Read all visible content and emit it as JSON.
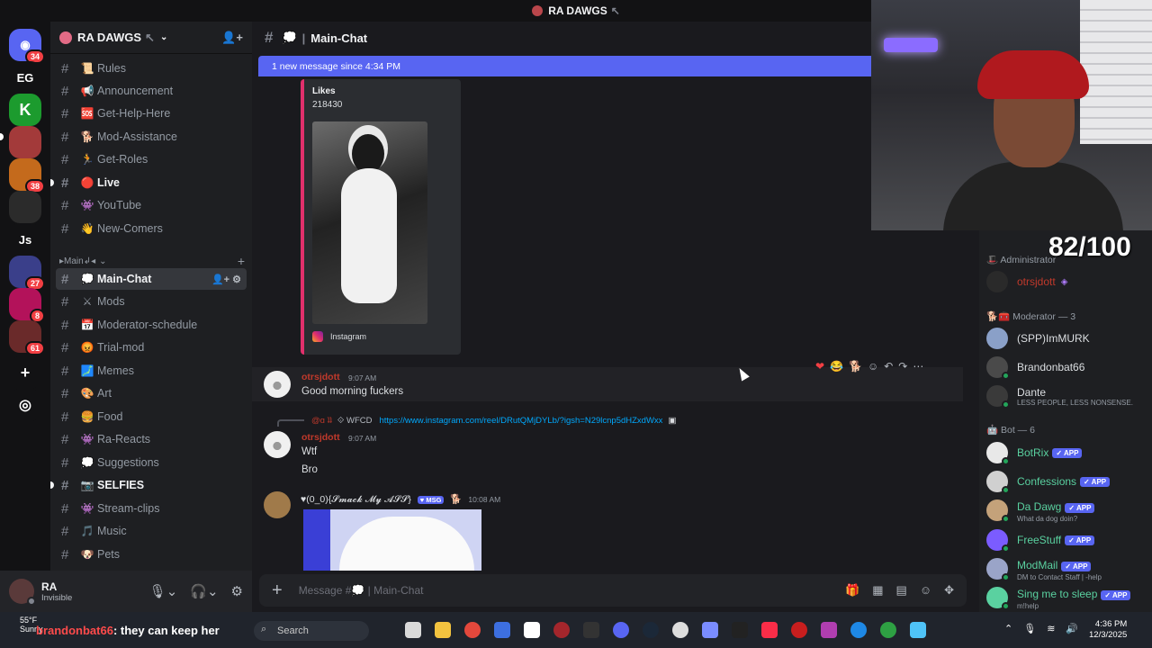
{
  "window_title": "RA DAWGS",
  "window_title_suffix": "↖",
  "servers": [
    {
      "label": "",
      "badge": "34",
      "color": "#5865f2"
    },
    {
      "label": "EG",
      "badge": "",
      "color": "#121214"
    },
    {
      "label": "",
      "badge": "",
      "color": "#1c9b2e"
    },
    {
      "label": "",
      "badge": "",
      "color": "#a33a3a"
    },
    {
      "label": "",
      "badge": "38",
      "color": "#c46a1c"
    },
    {
      "label": "",
      "badge": "",
      "color": "#2b2b2b"
    },
    {
      "label": "Js",
      "badge": "",
      "color": "#121214"
    },
    {
      "label": "",
      "badge": "27",
      "color": "#3a3f8a"
    },
    {
      "label": "",
      "badge": "8",
      "color": "#b3125a"
    },
    {
      "label": "",
      "badge": "61",
      "color": "#6a2a2a"
    }
  ],
  "guild": {
    "name": "RA DAWGS",
    "suffix": "↖"
  },
  "channels": [
    {
      "emoji": "📜",
      "name": "Rules",
      "unread": false
    },
    {
      "emoji": "📢",
      "name": "Announcement",
      "unread": false
    },
    {
      "emoji": "🆘",
      "name": "Get-Help-Here",
      "unread": false
    },
    {
      "emoji": "🐕",
      "name": "Mod-Assistance",
      "unread": false
    },
    {
      "emoji": "🏃",
      "name": "Get-Roles",
      "unread": false
    },
    {
      "emoji": "🔴",
      "name": "Live",
      "unread": true
    },
    {
      "emoji": "👾",
      "name": "YouTube",
      "unread": false
    },
    {
      "emoji": "👋",
      "name": "New-Comers",
      "unread": false
    }
  ],
  "category": {
    "name": "▸Main↲◂",
    "caret": "⌄"
  },
  "channels2": [
    {
      "emoji": "💭",
      "name": "Main-Chat",
      "active": true,
      "unread": false
    },
    {
      "emoji": "⚔",
      "name": "Mods",
      "active": false,
      "unread": false
    },
    {
      "emoji": "📅",
      "name": "Moderator-schedule",
      "active": false,
      "unread": false
    },
    {
      "emoji": "😡",
      "name": "Trial-mod",
      "active": false,
      "unread": false
    },
    {
      "emoji": "🗾",
      "name": "Memes",
      "active": false,
      "unread": false
    },
    {
      "emoji": "🎨",
      "name": "Art",
      "active": false,
      "unread": false
    },
    {
      "emoji": "🍔",
      "name": "Food",
      "active": false,
      "unread": false
    },
    {
      "emoji": "👾",
      "name": "Ra-Reacts",
      "active": false,
      "unread": false
    },
    {
      "emoji": "💭",
      "name": "Suggestions",
      "active": false,
      "unread": false
    },
    {
      "emoji": "📷",
      "name": "SELFIES",
      "active": false,
      "unread": true
    },
    {
      "emoji": "👾",
      "name": "Stream-clips",
      "active": false,
      "unread": false
    },
    {
      "emoji": "🎵",
      "name": "Music",
      "active": false,
      "unread": false
    },
    {
      "emoji": "🐶",
      "name": "Pets",
      "active": false,
      "unread": false
    }
  ],
  "user": {
    "name": "RA",
    "status": "Invisible"
  },
  "channel_header": {
    "emoji": "💭",
    "name": "Main-Chat"
  },
  "new_messages_bar": "1 new message since 4:34 PM",
  "embed": {
    "field_label": "Likes",
    "field_value": "218430",
    "provider": "Instagram"
  },
  "messages": [
    {
      "author": "otrsjdott",
      "time": "9:07 AM",
      "lines": [
        "Good morning fuckers"
      ]
    },
    {
      "author": "otrsjdott",
      "time": "9:07 AM",
      "lines": [
        "Wtf",
        "Bro"
      ],
      "reply": {
        "author": "@ɑ ʇʇ",
        "tag": "WFCD",
        "link": "https://www.instagram.com/reel/DRutQMjDYLb/?igsh=N29lcnp5dHZxdWxx"
      }
    },
    {
      "author": "♥(0_0){𝓢𝓶𝓪𝓬𝓴 𝓜𝔂 𝓐𝓢𝓢}",
      "tag": "MSG",
      "time": "10:08 AM",
      "lines": []
    }
  ],
  "composer": {
    "placeholder": "Message #💭 | Main-Chat"
  },
  "members": {
    "admin_header": "Administrator",
    "admin_name": "otrsjdott",
    "mod_header": "Moderator — 3",
    "mods": [
      {
        "name": "(SPP)ImMURK",
        "sub": ""
      },
      {
        "name": "Brandonbat66",
        "sub": ""
      },
      {
        "name": "Dante",
        "sub": "LESS PEOPLE, LESS NONSENSE."
      }
    ],
    "bot_header": "Bot — 6",
    "bots": [
      {
        "name": "BotRix",
        "sub": ""
      },
      {
        "name": "Confessions",
        "sub": ""
      },
      {
        "name": "Da Dawg",
        "sub": "What da dog doin?"
      },
      {
        "name": "FreeStuff",
        "sub": ""
      },
      {
        "name": "ModMail",
        "sub": "DM to Contact Staff | -help"
      },
      {
        "name": "Sing me to sleep",
        "sub": "m!help"
      }
    ],
    "app_label": "✓ APP"
  },
  "overlay_score": "82/100",
  "taskbar": {
    "weather": "55°F",
    "weather_sub": "Sunny",
    "ticker_name": "brandonbat66",
    "ticker_text": ": they can keep her",
    "search": "Search",
    "time": "4:36 PM",
    "date": "12/3/2025"
  }
}
